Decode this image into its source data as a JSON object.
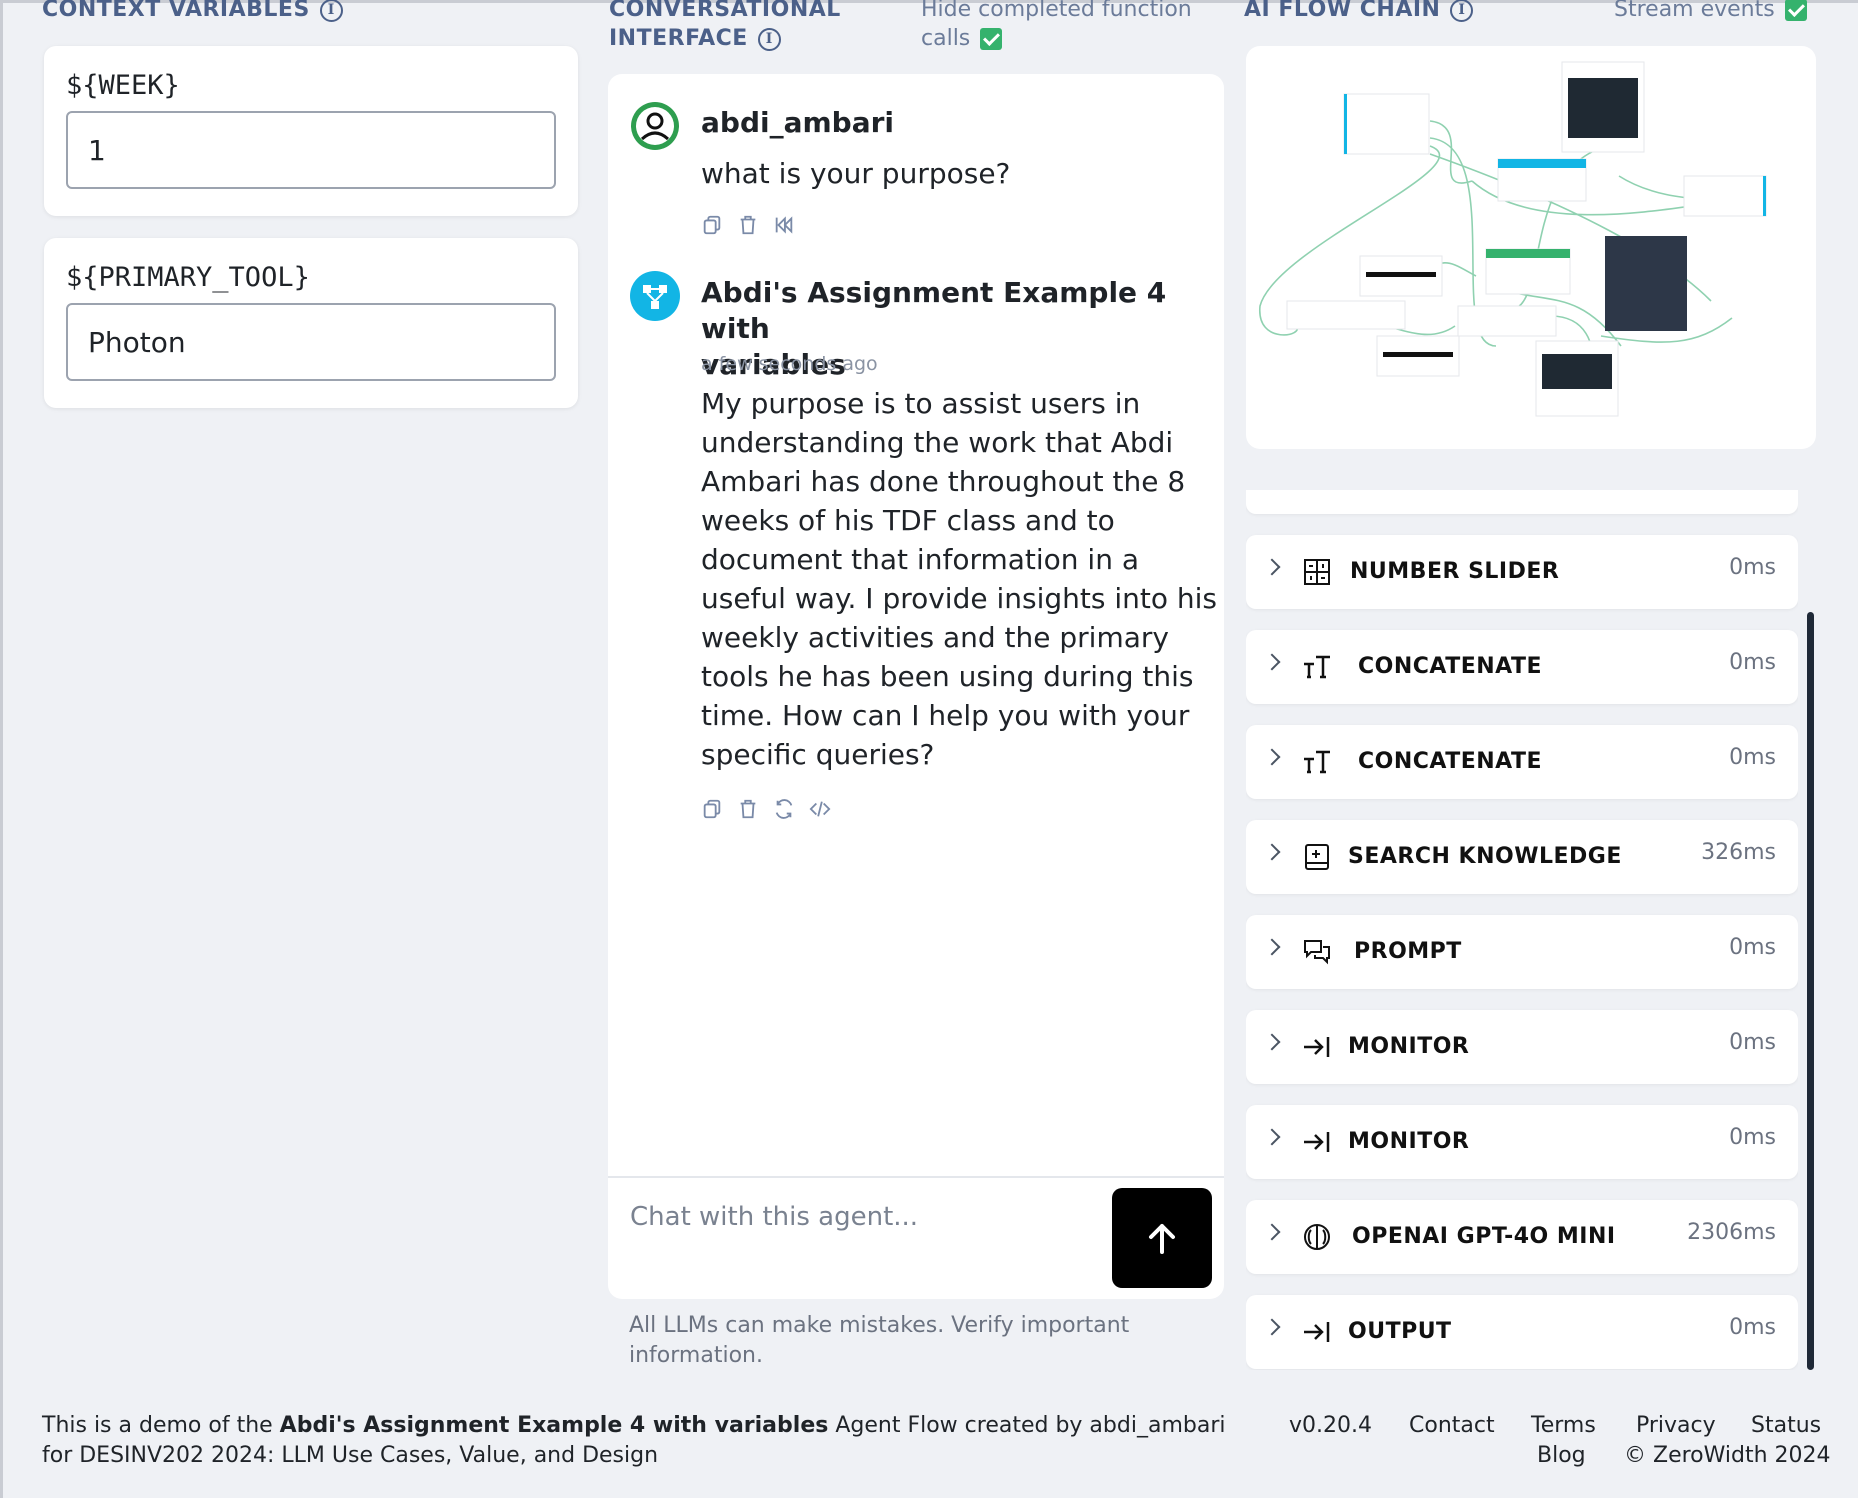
{
  "context_variables": {
    "title": "CONTEXT VARIABLES",
    "items": [
      {
        "label": "${WEEK}",
        "value": "1"
      },
      {
        "label": "${PRIMARY_TOOL}",
        "value": "Photon"
      }
    ]
  },
  "conversation": {
    "title_line1": "CONVERSATIONAL",
    "title_line2": "INTERFACE",
    "hide_toggle_line1": "Hide completed function",
    "hide_toggle_line2": "calls",
    "hide_checked": true,
    "messages": [
      {
        "author": "abdi_ambari",
        "text": "what is your purpose?"
      },
      {
        "author_line1": "Abdi's Assignment Example 4 with",
        "author_line2": "variables",
        "time": "a few seconds ago",
        "lines": [
          "My purpose is to assist users in",
          "understanding the work that Abdi",
          "Ambari has done throughout the 8",
          "weeks of his TDF class and to",
          "document that information in a",
          "useful way. I provide insights into his",
          "weekly activities and the primary",
          "tools he has been using during this",
          "time. How can I help you with your",
          "specific queries?"
        ]
      }
    ],
    "input_placeholder": "Chat with this agent...",
    "disclaimer": "All LLMs can make mistakes. Verify important information."
  },
  "flow_chain": {
    "title": "AI FLOW CHAIN",
    "stream_label": "Stream events",
    "stream_checked": true,
    "items": [
      {
        "label": "NUMBER SLIDER",
        "time": "0ms",
        "icon": "grid-icon"
      },
      {
        "label": "CONCATENATE",
        "time": "0ms",
        "icon": "text-icon"
      },
      {
        "label": "CONCATENATE",
        "time": "0ms",
        "icon": "text-icon"
      },
      {
        "label": "SEARCH KNOWLEDGE",
        "time": "326ms",
        "icon": "search-book-icon"
      },
      {
        "label": "PROMPT",
        "time": "0ms",
        "icon": "chat-bubbles-icon"
      },
      {
        "label": "MONITOR",
        "time": "0ms",
        "icon": "arrow-to-line-icon"
      },
      {
        "label": "MONITOR",
        "time": "0ms",
        "icon": "arrow-to-line-icon"
      },
      {
        "label": "OPENAI GPT-4O MINI",
        "time": "2306ms",
        "icon": "brain-icon"
      },
      {
        "label": "OUTPUT",
        "time": "0ms",
        "icon": "arrow-to-line-icon"
      }
    ]
  },
  "footer": {
    "prefix": "This is a demo of the ",
    "flow_name": "Abdi's Assignment Example 4 with variables",
    "suffix": " Agent Flow created by abdi_ambari for DESINV202 2024: LLM Use Cases, Value, and Design",
    "version": "v0.20.4",
    "contact": "Contact",
    "terms": "Terms",
    "privacy": "Privacy",
    "status": "Status",
    "blog": "Blog",
    "copyright": "© ZeroWidth 2024"
  },
  "colors": {
    "accent": "#4b6089",
    "check": "#35b26d",
    "user_avatar": "#2e9e4f",
    "bot_avatar": "#12b5e5"
  }
}
